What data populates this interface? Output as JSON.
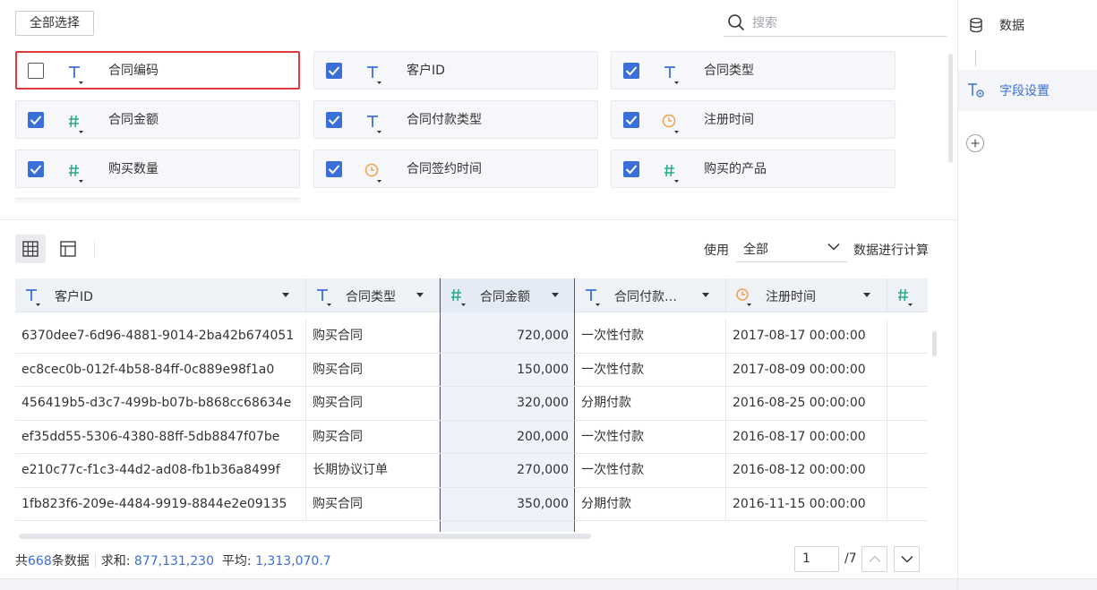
{
  "toolbar": {
    "select_all": "全部选择",
    "search_placeholder": "搜索"
  },
  "fields": [
    {
      "name": "合同编码",
      "type": "text",
      "checked": false,
      "focused": true
    },
    {
      "name": "客户ID",
      "type": "text",
      "checked": true
    },
    {
      "name": "合同类型",
      "type": "text",
      "checked": true
    },
    {
      "name": "合同金额",
      "type": "number",
      "checked": true
    },
    {
      "name": "合同付款类型",
      "type": "text",
      "checked": true
    },
    {
      "name": "注册时间",
      "type": "date",
      "checked": true
    },
    {
      "name": "购买数量",
      "type": "number",
      "checked": true
    },
    {
      "name": "合同签约时间",
      "type": "date",
      "checked": true
    },
    {
      "name": "购买的产品",
      "type": "number",
      "checked": true
    }
  ],
  "view": {
    "use_label": "使用",
    "use_value": "全部",
    "use_suffix": "数据进行计算"
  },
  "table": {
    "columns": [
      {
        "label": "客户ID",
        "type": "text"
      },
      {
        "label": "合同类型",
        "type": "text"
      },
      {
        "label": "合同金额",
        "type": "number",
        "selected": true
      },
      {
        "label": "合同付款…",
        "type": "text"
      },
      {
        "label": "注册时间",
        "type": "date"
      },
      {
        "label": "",
        "type": "number"
      }
    ],
    "rows": [
      [
        "6370dee7-6d96-4881-9014-2ba42b674051",
        "购买合同",
        "720,000",
        "一次性付款",
        "2017-08-17 00:00:00"
      ],
      [
        "ec8cec0b-012f-4b58-84ff-0c889e98f1a0",
        "购买合同",
        "150,000",
        "一次性付款",
        "2017-08-09 00:00:00"
      ],
      [
        "456419b5-d3c7-499b-b07b-b868cc68634e",
        "购买合同",
        "320,000",
        "分期付款",
        "2016-08-25 00:00:00"
      ],
      [
        "ef35dd55-5306-4380-88ff-5db8847f07be",
        "购买合同",
        "200,000",
        "一次性付款",
        "2016-08-17 00:00:00"
      ],
      [
        "e210c77c-f1c3-44d2-ad08-fb1b36a8499f",
        "长期协议订单",
        "270,000",
        "一次性付款",
        "2016-08-12 00:00:00"
      ],
      [
        "1fb823f6-209e-4484-9919-8844e2e09135",
        "购买合同",
        "350,000",
        "分期付款",
        "2016-11-15 00:00:00"
      ]
    ]
  },
  "footer": {
    "total_prefix": "共",
    "total_count": "668",
    "total_suffix": "条数据",
    "sum_label": "求和:",
    "sum_value": "877,131,230",
    "avg_label": "平均:",
    "avg_value": "1,313,070.7",
    "page_current": "1",
    "page_total": "/7"
  },
  "sidebar": {
    "steps": [
      {
        "label": "数据",
        "icon": "database-icon",
        "active": false
      },
      {
        "label": "字段设置",
        "icon": "field-settings-icon",
        "active": true
      }
    ]
  },
  "colors": {
    "accent": "#3a6fd8",
    "text_type_icon": "#3a6fd8",
    "number_type_icon": "#29a88c",
    "date_type_icon": "#f0a04b",
    "focus_border": "#e0393e"
  }
}
